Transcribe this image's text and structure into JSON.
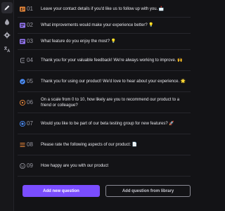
{
  "rail": {
    "items": [
      {
        "icon": "edit-icon",
        "active": true
      },
      {
        "icon": "drop-icon",
        "active": false
      },
      {
        "icon": "gear-icon",
        "active": false
      },
      {
        "icon": "translate-icon",
        "active": false
      }
    ]
  },
  "questions": [
    {
      "num": "01",
      "icon": "contact-info-icon",
      "text": "Leave your contact details if you'd like us to follow up with you. 📩"
    },
    {
      "num": "02",
      "icon": "long-text-icon",
      "text": "What improvements would make your experience better? 💡"
    },
    {
      "num": "03",
      "icon": "long-text-icon",
      "text": "What feature do you enjoy the most? 💡"
    },
    {
      "num": "04",
      "icon": "statement-icon",
      "text": "Thank you for your valuable feedback! We're always working to improve. 🙌"
    },
    {
      "num": "05",
      "icon": "end-screen-icon",
      "text": "Thank you for using our product! We'd love to hear about your experience. 🌟"
    },
    {
      "num": "06",
      "icon": "nps-icon",
      "text": "On a scale from 0 to 10, how likely are you to recommend our product to a friend or colleague?"
    },
    {
      "num": "07",
      "icon": "yes-no-icon",
      "text": "Would you like to be part of our beta testing group for new features? 🚀"
    },
    {
      "num": "08",
      "icon": "matrix-icon",
      "text": "Please rate the following aspects of our product: 📄"
    },
    {
      "num": "09",
      "icon": "rating-icon",
      "text": "How happy are you with our product"
    }
  ],
  "actions": {
    "add_new_question": "Add new question",
    "add_from_library": "Add question from library"
  },
  "colors": {
    "background": "#131316",
    "accent": "#7a4dff",
    "orange": "#e8873a",
    "purple": "#9b7bff",
    "blue": "#4b8df8",
    "grey": "#9a9aa4"
  }
}
